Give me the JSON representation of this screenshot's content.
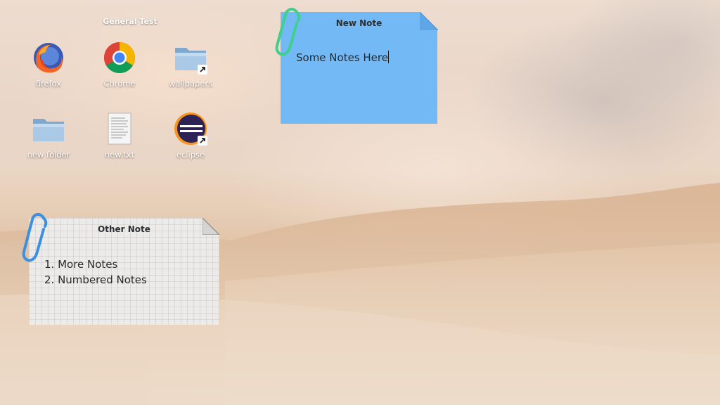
{
  "desktop": {
    "group_title": "General Test",
    "icons": [
      {
        "label": "firefox",
        "icon": "firefox-icon"
      },
      {
        "label": "Chrome",
        "icon": "chrome-icon"
      },
      {
        "label": "wallpapers",
        "icon": "folder-link-icon"
      },
      {
        "label": "new folder",
        "icon": "folder-icon"
      },
      {
        "label": "new.txt",
        "icon": "text-file-icon"
      },
      {
        "label": "eclipse",
        "icon": "eclipse-icon"
      }
    ]
  },
  "notes": {
    "new_note": {
      "title": "New Note",
      "body": "Some Notes Here",
      "color": "#72b9f5",
      "clip_color": "#3fcf8e"
    },
    "other_note": {
      "title": "Other Note",
      "items": [
        "1. More Notes",
        "2. Numbered Notes"
      ],
      "color": "#ecebe9",
      "clip_color": "#3d8fe0"
    }
  }
}
